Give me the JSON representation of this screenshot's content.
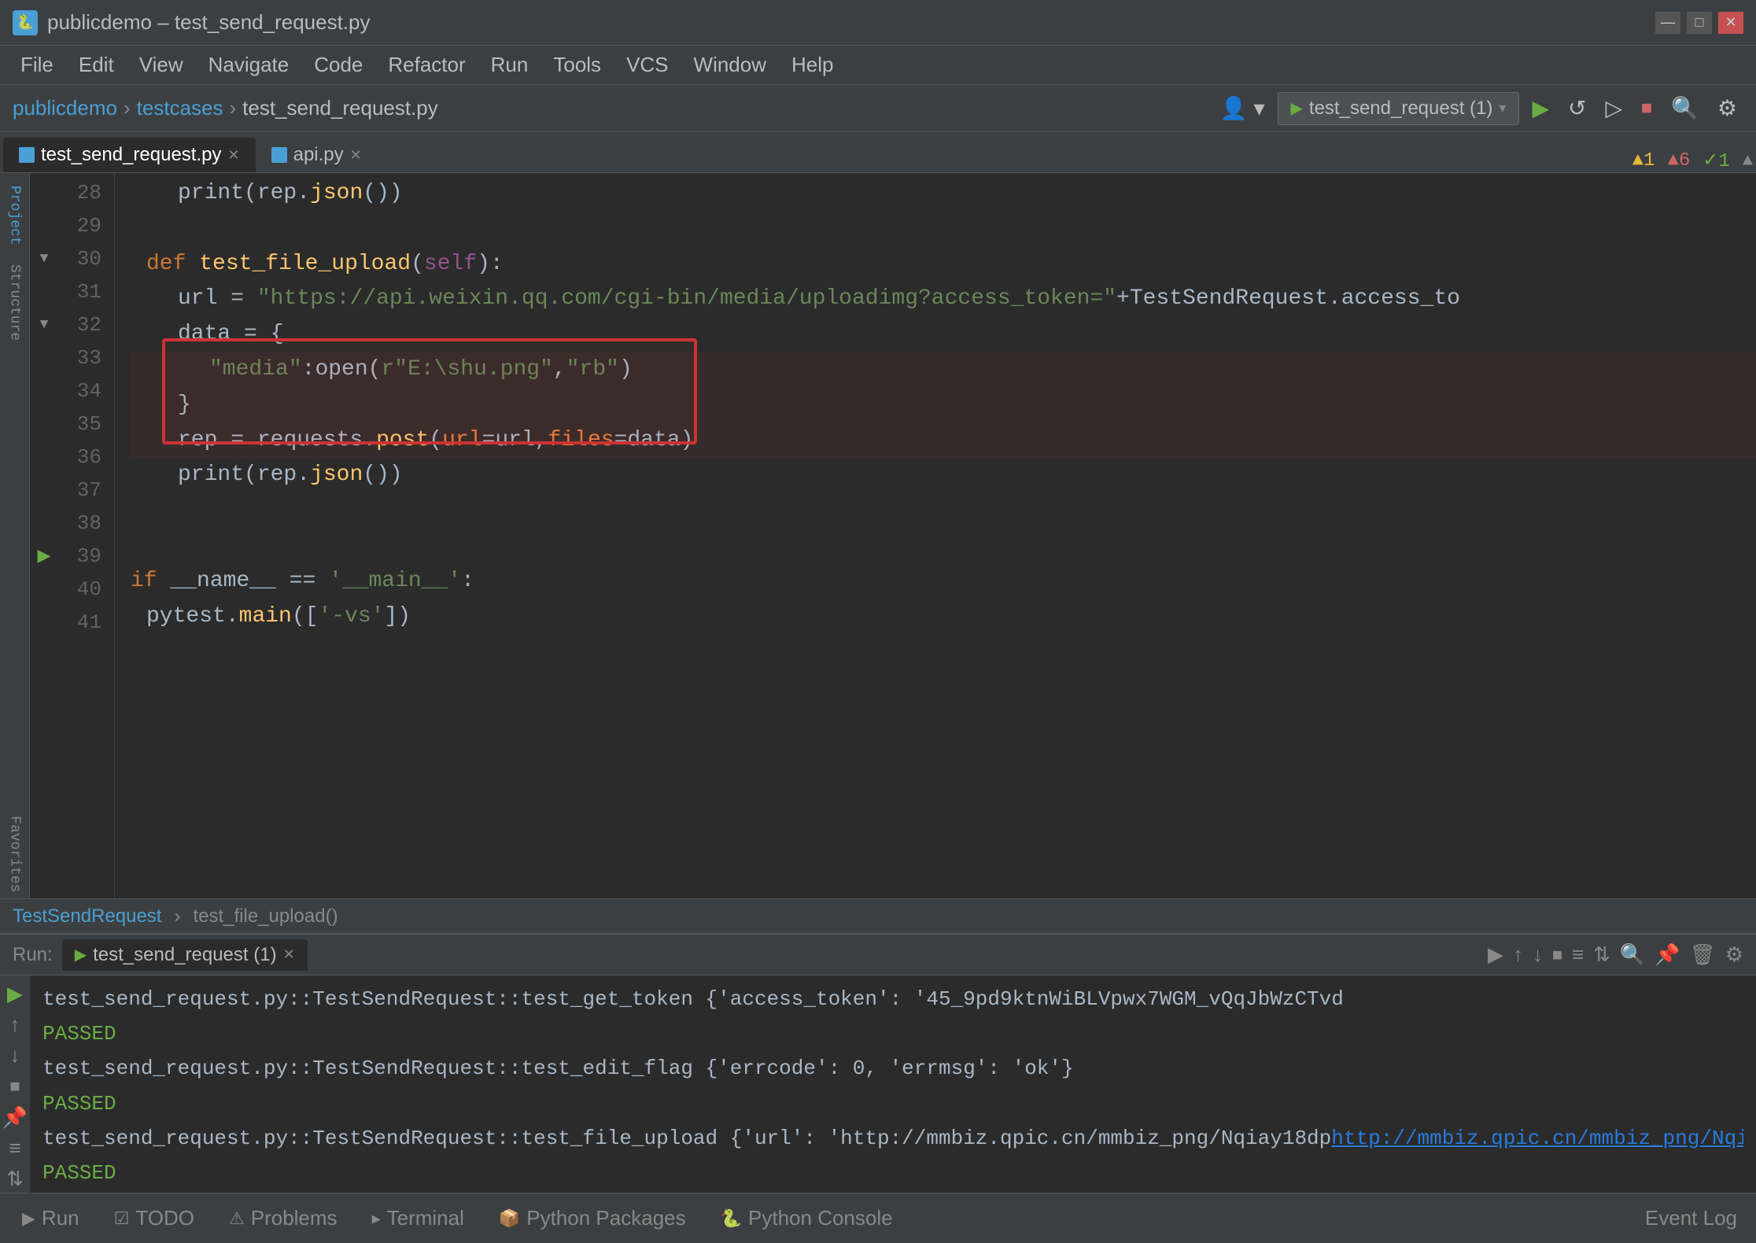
{
  "titleBar": {
    "icon": "🐍",
    "title": "publicdemo – test_send_request.py",
    "controls": [
      "—",
      "□",
      "✕"
    ]
  },
  "menuBar": {
    "items": [
      "File",
      "Edit",
      "View",
      "Navigate",
      "Code",
      "Refactor",
      "Run",
      "Tools",
      "VCS",
      "Window",
      "Help"
    ]
  },
  "toolbar": {
    "breadcrumbs": [
      "publicdemo",
      "testcases",
      "test_send_request.py"
    ],
    "runConfig": "test_send_request (1)",
    "buttons": [
      "▶",
      "↺",
      "⏹",
      "🔍",
      "⚙"
    ]
  },
  "editorTabs": [
    {
      "label": "test_send_request.py",
      "active": true,
      "closable": true
    },
    {
      "label": "api.py",
      "active": false,
      "closable": true
    }
  ],
  "codeLines": [
    {
      "num": 28,
      "indent": 8,
      "code": "print(rep.json())",
      "gutter": ""
    },
    {
      "num": 29,
      "indent": 0,
      "code": "",
      "gutter": ""
    },
    {
      "num": 30,
      "indent": 4,
      "code": "def test_file_upload(self):",
      "gutter": "▼",
      "foldable": true
    },
    {
      "num": 31,
      "indent": 8,
      "code": "url = \"https://api.weixin.qq.com/cgi-bin/media/uploadimg?access_token=\"+TestSendRequest.access_to",
      "gutter": ""
    },
    {
      "num": 32,
      "indent": 8,
      "code": "data = {",
      "gutter": "▼",
      "foldable": true
    },
    {
      "num": 33,
      "indent": 12,
      "code": "\"media\":open(r\"E:\\shu.png\",\"rb\")",
      "gutter": "",
      "highlighted": true
    },
    {
      "num": 34,
      "indent": 8,
      "code": "}",
      "gutter": "",
      "highlighted": true
    },
    {
      "num": 35,
      "indent": 8,
      "code": "rep = requests.post(url=url,files=data)",
      "gutter": "",
      "highlighted": true
    },
    {
      "num": 36,
      "indent": 8,
      "code": "print(rep.json())",
      "gutter": ""
    },
    {
      "num": 37,
      "indent": 0,
      "code": "",
      "gutter": ""
    },
    {
      "num": 38,
      "indent": 0,
      "code": "",
      "gutter": ""
    },
    {
      "num": 39,
      "indent": 0,
      "code": "if __name__ == '__main__':",
      "gutter": "▶"
    },
    {
      "num": 40,
      "indent": 4,
      "code": "pytest.main(['-vs'])",
      "gutter": ""
    },
    {
      "num": 41,
      "indent": 0,
      "code": "",
      "gutter": ""
    }
  ],
  "warningIndicators": {
    "warnings": "▲1",
    "errors": "▲6",
    "ok": "✓1"
  },
  "editorStatusBar": {
    "class": "TestSendRequest",
    "method": "test_file_upload()"
  },
  "runPanel": {
    "label": "Run:",
    "activeTab": "test_send_request (1)",
    "output": [
      "test_send_request.py::TestSendRequest::test_get_token {'access_token': '45_9pd9ktnWiBLVpwx7WGM_vQqJbWzCTvd",
      "PASSED",
      "test_send_request.py::TestSendRequest::test_edit_flag {'errcode': 0, 'errmsg': 'ok'}",
      "PASSED",
      "test_send_request.py::TestSendRequest::test_file_upload {'url': 'http://mmbiz.qpic.cn/mmbiz_png/Nqiay18dp",
      "PASSED"
    ]
  },
  "bottomTabs": {
    "items": [
      {
        "label": "Run",
        "icon": "▶",
        "active": false
      },
      {
        "label": "TODO",
        "icon": "☑",
        "active": false
      },
      {
        "label": "Problems",
        "icon": "⚠",
        "active": false
      },
      {
        "label": "Terminal",
        "icon": "▸",
        "active": false
      },
      {
        "label": "Python Packages",
        "icon": "📦",
        "active": false
      },
      {
        "label": "Python Console",
        "icon": "🐍",
        "active": false
      }
    ],
    "eventLog": "Event Log"
  }
}
